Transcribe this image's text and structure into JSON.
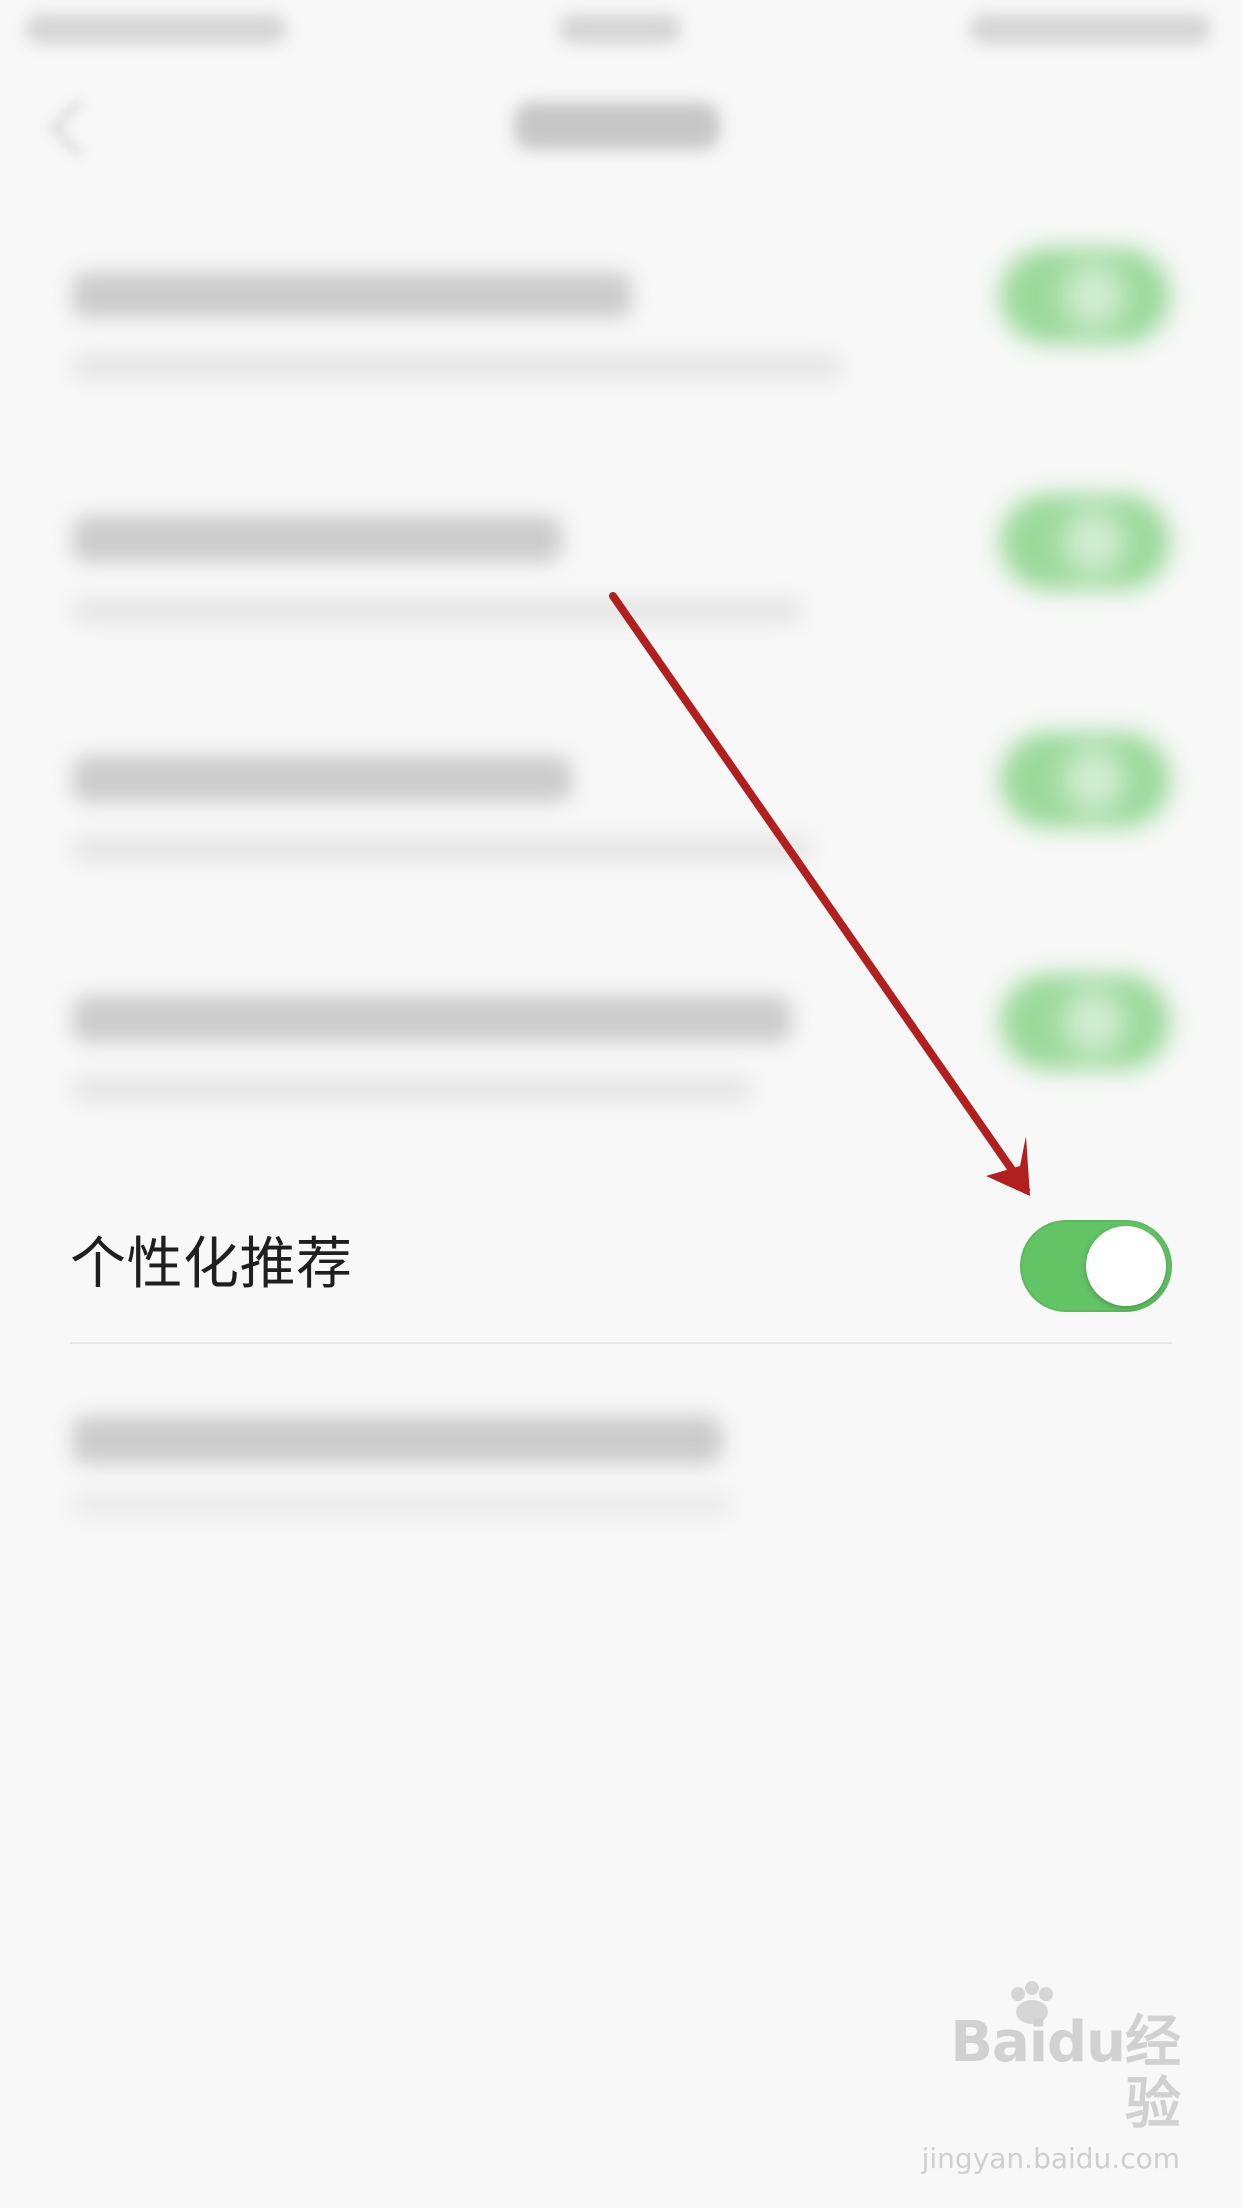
{
  "settings": {
    "rows": [
      {
        "label": "",
        "enabled": true
      },
      {
        "label": "",
        "enabled": true
      },
      {
        "label": "",
        "enabled": true
      },
      {
        "label": "",
        "enabled": true
      },
      {
        "label": "个性化推荐",
        "enabled": true
      },
      {
        "label": ""
      }
    ],
    "colors": {
      "toggle_on": "#63c465",
      "annotation_arrow": "#b21f1f"
    }
  },
  "watermark": {
    "brand": "Baidu经验",
    "url": "jingyan.baidu.com",
    "icon": "paw-icon"
  }
}
